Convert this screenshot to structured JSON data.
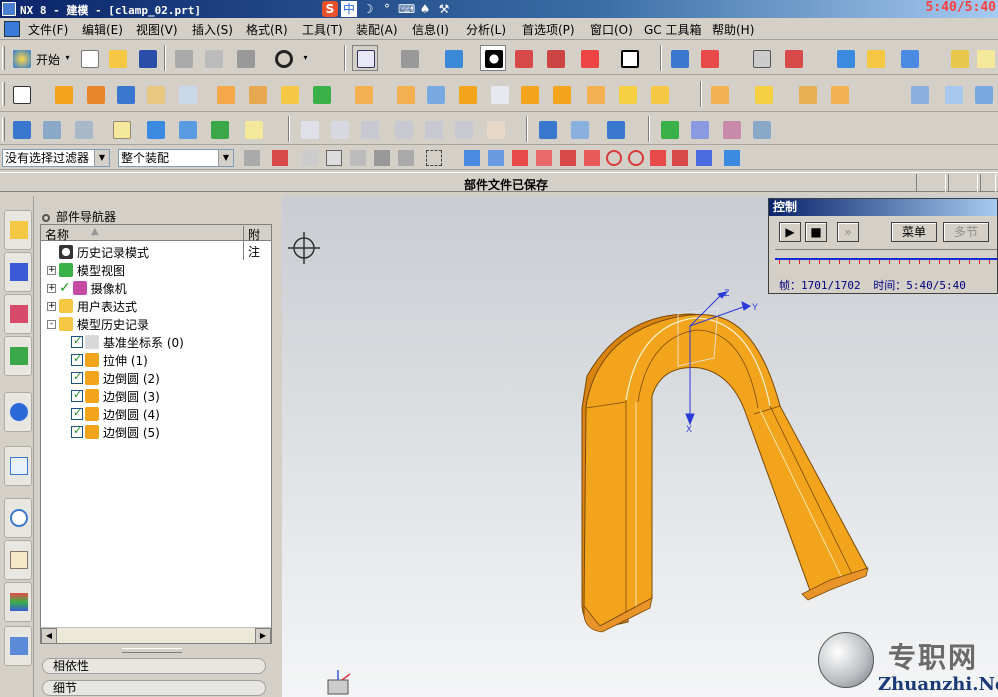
{
  "window": {
    "title": "NX 8 - 建模 - [clamp_02.prt]",
    "clock": "5:40/5:40"
  },
  "menu": {
    "items": [
      "文件(F)",
      "编辑(E)",
      "视图(V)",
      "插入(S)",
      "格式(R)",
      "工具(T)",
      "装配(A)",
      "信息(I)",
      "分析(L)",
      "首选项(P)",
      "窗口(O)",
      "GC 工具箱",
      "帮助(H)"
    ]
  },
  "toolbar": {
    "start_label": "开始"
  },
  "selection_bar": {
    "filter": "没有选择过滤器",
    "scope": "整个装配"
  },
  "status": {
    "message": "部件文件已保存"
  },
  "navigator": {
    "title": "部件导航器",
    "col_name": "名称",
    "col_attach": "附注",
    "tree": [
      {
        "label": "历史记录模式",
        "level": 0,
        "expander": "",
        "icon": "clock-icon"
      },
      {
        "label": "模型视图",
        "level": 0,
        "expander": "+",
        "icon": "views-icon"
      },
      {
        "label": "摄像机",
        "level": 0,
        "expander": "+",
        "icon": "camera-icon"
      },
      {
        "label": "用户表达式",
        "level": 0,
        "expander": "+",
        "icon": "folder-icon"
      },
      {
        "label": "模型历史记录",
        "level": 0,
        "expander": "-",
        "icon": "folder-open-icon"
      },
      {
        "label": "基准坐标系 (0)",
        "level": 1,
        "expander": "",
        "icon": "csys-icon"
      },
      {
        "label": "拉伸 (1)",
        "level": 1,
        "expander": "",
        "icon": "extrude-icon"
      },
      {
        "label": "边倒圆 (2)",
        "level": 1,
        "expander": "",
        "icon": "blend-icon"
      },
      {
        "label": "边倒圆 (3)",
        "level": 1,
        "expander": "",
        "icon": "blend-icon"
      },
      {
        "label": "边倒圆 (4)",
        "level": 1,
        "expander": "",
        "icon": "blend-icon"
      },
      {
        "label": "边倒圆 (5)",
        "level": 1,
        "expander": "",
        "icon": "blend-icon"
      }
    ],
    "sections": [
      "相依性",
      "细节"
    ]
  },
  "control_dialog": {
    "title": "控制",
    "menu_btn": "菜单",
    "multi_btn": "多节",
    "frame_label": "帧：",
    "frame_value": "1701/1702",
    "time_label": "时间：",
    "time_value": "5:40/5:40"
  },
  "axes": {
    "x": "X",
    "y": "Y",
    "z": "Z"
  },
  "watermark": {
    "cn": "专职网",
    "en": "Zhuanzhi.Net"
  },
  "colors": {
    "part_orange": "#f2a41c",
    "part_shade": "#d98410",
    "title_blue": "#0a246a"
  }
}
